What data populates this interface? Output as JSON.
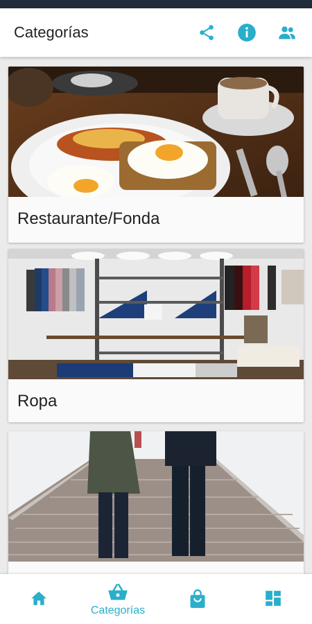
{
  "header": {
    "title": "Categorías"
  },
  "icons": {
    "share": "share-icon",
    "info": "info-icon",
    "people": "people-icon"
  },
  "categories": [
    {
      "label": "Restaurante/Fonda",
      "image": "breakfast-photo"
    },
    {
      "label": "Ropa",
      "image": "clothing-store-photo"
    },
    {
      "label": "",
      "image": "people-on-pier-photo"
    }
  ],
  "bottom_nav": {
    "items": [
      {
        "icon": "home-icon",
        "label": ""
      },
      {
        "icon": "basket-icon",
        "label": "Categorías",
        "active": true
      },
      {
        "icon": "shopping-bag-icon",
        "label": ""
      },
      {
        "icon": "dashboard-icon",
        "label": ""
      }
    ]
  },
  "colors": {
    "accent": "#2aaecb",
    "statusbar": "#1f2d3a",
    "background": "#ebebeb"
  }
}
